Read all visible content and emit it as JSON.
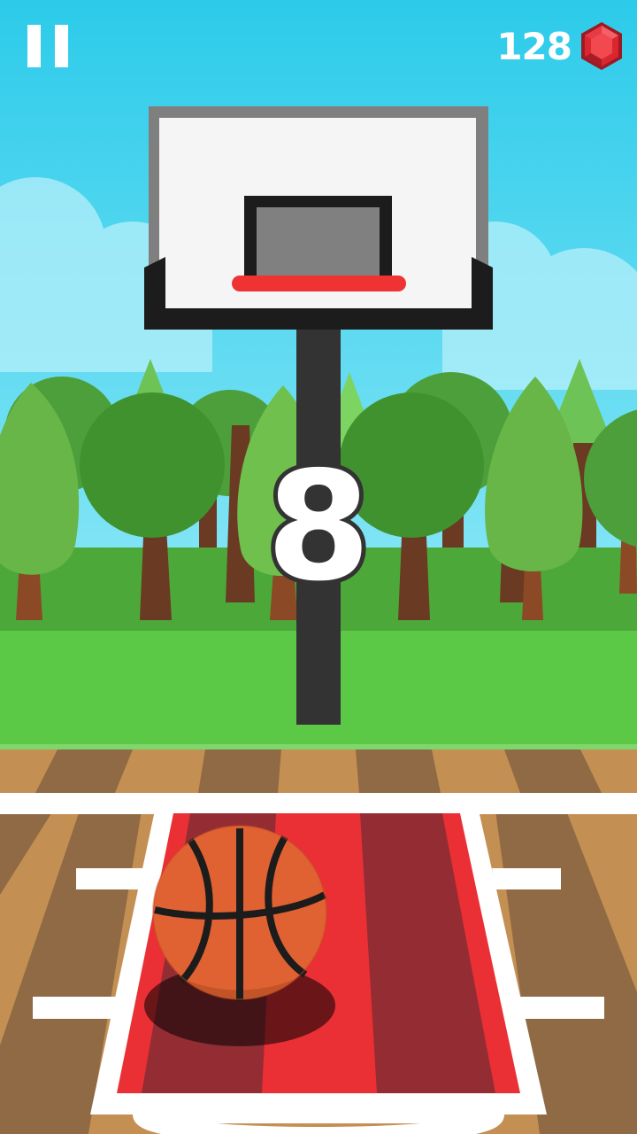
{
  "hud": {
    "pause_icon": "pause-icon",
    "gems": "128",
    "gem_icon": "ruby-gem-icon"
  },
  "score": "8",
  "colors": {
    "sky": "#2ccbea",
    "grass": "#5bc846",
    "court_wood": "#c48f52",
    "key_paint": "#ea3035",
    "rim": "#ef3333",
    "gem": "#d9262f",
    "ball": "#e06132"
  }
}
